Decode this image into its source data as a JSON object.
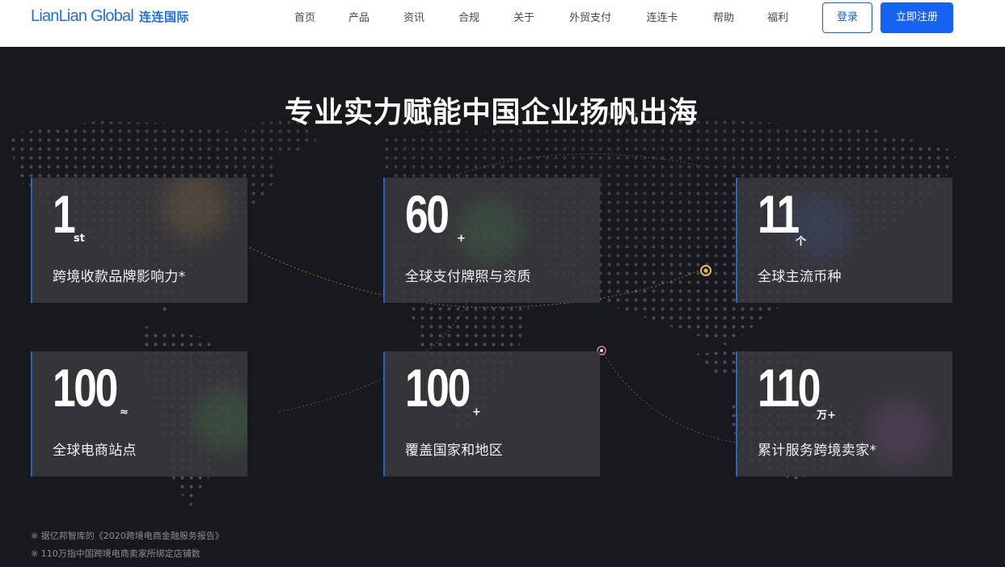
{
  "header": {
    "logo_en": "LianLian Global",
    "logo_cn": "连连国际",
    "nav": [
      "首页",
      "产品",
      "资讯",
      "合规",
      "关于",
      "外贸支付",
      "连连卡",
      "帮助",
      "福利"
    ],
    "login_label": "登录",
    "register_label": "立即注册"
  },
  "hero": {
    "title": "专业实力赋能中国企业扬帆出海",
    "stats": [
      {
        "value": "1",
        "unit": "st",
        "label": "跨境收款品牌影响力*"
      },
      {
        "value": "60",
        "unit": "+",
        "label": "全球支付牌照与资质"
      },
      {
        "value": "11",
        "unit": "个",
        "label": "全球主流币种"
      },
      {
        "value": "100",
        "unit": "≈",
        "label": "全球电商站点"
      },
      {
        "value": "100",
        "unit": "+",
        "label": "覆盖国家和地区"
      },
      {
        "value": "110",
        "unit": "万+",
        "label": "累计服务跨境卖家*"
      }
    ],
    "footnotes": [
      "※ 据亿邦智库的《2020跨境电商金融服务报告》",
      "※ 110万指中国跨境电商卖家所绑定店铺数"
    ]
  },
  "colors": {
    "brand_blue": "#1f6fde",
    "button_blue": "#1563f0",
    "card_accent": "#2a63c9",
    "hero_bg": "#18191c"
  }
}
